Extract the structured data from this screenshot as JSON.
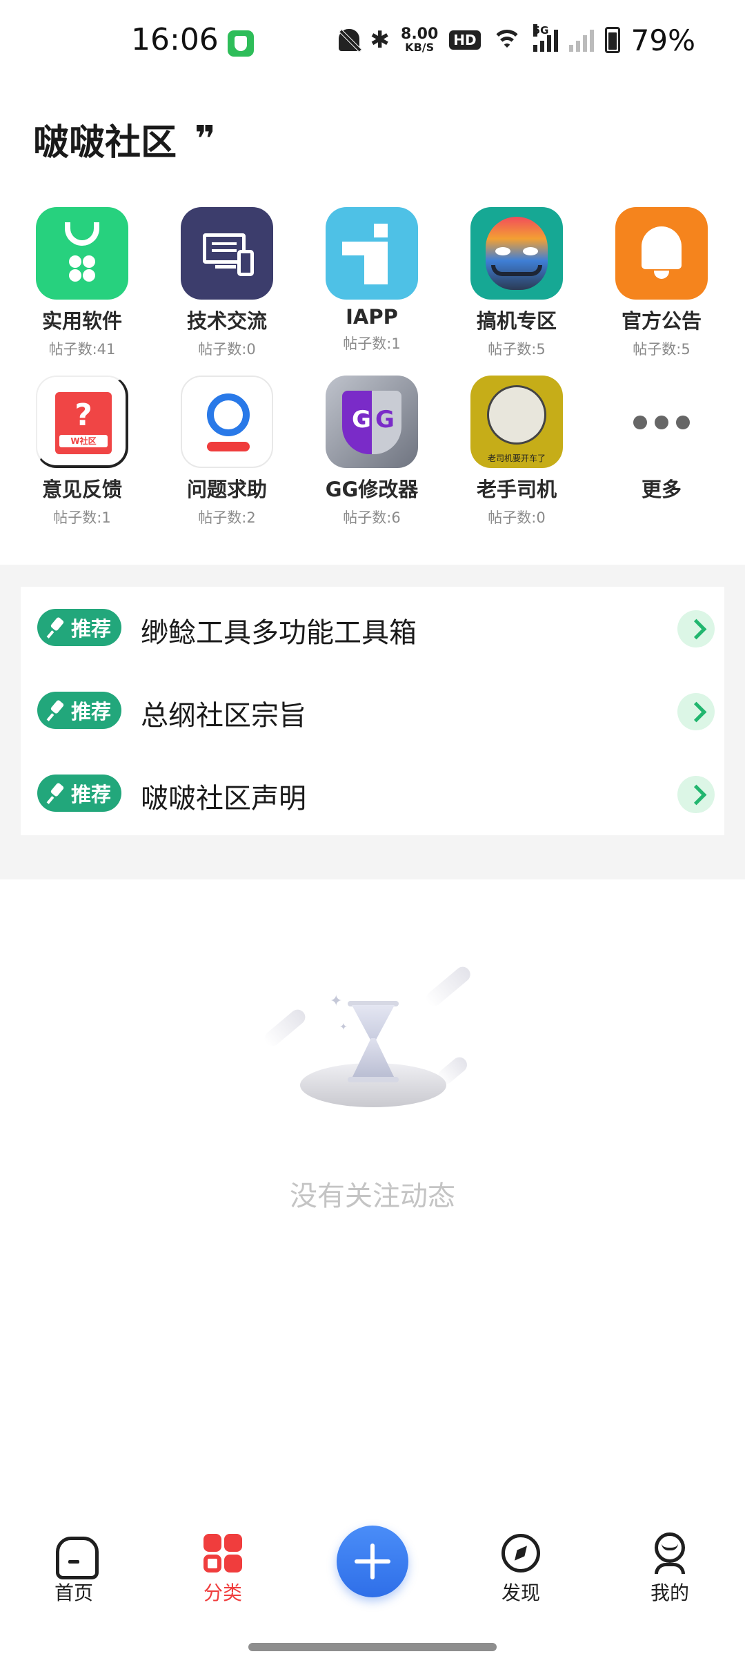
{
  "status_bar": {
    "time": "16:06",
    "net_speed_value": "8.00",
    "net_speed_unit": "KB/S",
    "hd_label": "HD",
    "signal_label": "5G",
    "battery": "79%"
  },
  "header": {
    "title": "啵啵社区"
  },
  "categories": [
    {
      "name": "实用软件",
      "count": "帖子数:41",
      "icon": "app-bag-icon"
    },
    {
      "name": "技术交流",
      "count": "帖子数:0",
      "icon": "computer-icon"
    },
    {
      "name": "IAPP",
      "count": "帖子数:1",
      "icon": "iapp-icon"
    },
    {
      "name": "搞机专区",
      "count": "帖子数:5",
      "icon": "mask-icon"
    },
    {
      "name": "官方公告",
      "count": "帖子数:5",
      "icon": "bell-icon"
    },
    {
      "name": "意见反馈",
      "count": "帖子数:1",
      "icon": "feedback-icon",
      "badge": "W社区"
    },
    {
      "name": "问题求助",
      "count": "帖子数:2",
      "icon": "help-icon"
    },
    {
      "name": "GG修改器",
      "count": "帖子数:6",
      "icon": "gg-icon",
      "glyph": "G"
    },
    {
      "name": "老手司机",
      "count": "帖子数:0",
      "icon": "meme-icon",
      "caption": "老司机要开车了"
    },
    {
      "name": "更多",
      "icon": "more-icon"
    }
  ],
  "recommended": {
    "badge_label": "推荐",
    "items": [
      {
        "title": "缈鲶工具多功能工具箱"
      },
      {
        "title": "总纲社区宗旨"
      },
      {
        "title": "啵啵社区声明"
      }
    ]
  },
  "empty_state": {
    "text": "没有关注动态",
    "icon": "hourglass-icon"
  },
  "bottom_nav": {
    "items": [
      {
        "label": "首页",
        "icon": "home-icon"
      },
      {
        "label": "分类",
        "icon": "category-icon",
        "active": true
      },
      {
        "label": "发现",
        "icon": "compass-icon"
      },
      {
        "label": "我的",
        "icon": "profile-icon"
      }
    ],
    "fab_icon": "plus-icon"
  },
  "colors": {
    "accent": "#f03d3d",
    "recommend_badge": "#22a77b",
    "fab": "#2f6fe8",
    "arrow_bg": "#dcf6e6"
  }
}
